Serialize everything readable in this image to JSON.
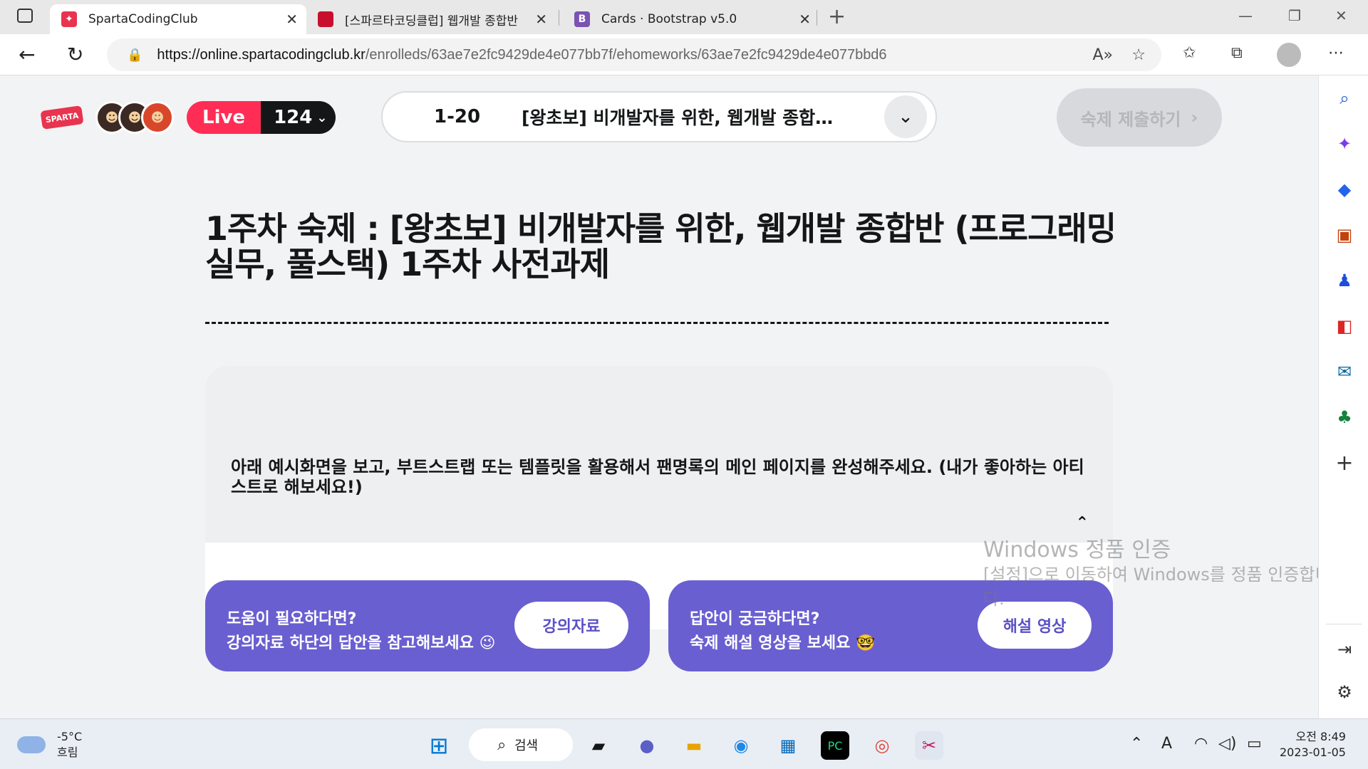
{
  "browser": {
    "tabs": [
      {
        "label": "SpartaCodingClub",
        "active": true,
        "favicon_color": "#e8344e"
      },
      {
        "label": "[스파르타코딩클럽] 웹개발 종합반",
        "active": false,
        "favicon_color": "#c8102e"
      },
      {
        "label": "Cards · Bootstrap v5.0",
        "active": false,
        "favicon_color": "#7952b3",
        "favicon_letter": "B"
      }
    ],
    "url_domain": "https://online.spartacodingclub.kr",
    "url_path": "/enrolleds/63ae7e2fc9429de4e077bb7f/ehomeworks/63ae7e2fc9429de4e077bbd6"
  },
  "header": {
    "logo_text": "SPARTA",
    "live_label": "Live",
    "live_count": "124",
    "selector_num": "1-20",
    "selector_title": "[왕초보] 비개발자를 위한, 웹개발 종합반 (…",
    "submit_label": "숙제 제출하기"
  },
  "homework": {
    "title": "1주차 숙제 : [왕초보] 비개발자를 위한, 웹개발 종합반 (프로그래밍 실무, 풀스택) 1주차 사전과제",
    "question": "아래 예시화면을 보고, 부트스트랩 또는 템플릿을 활용해서 팬명록의 메인 페이지를 완성해주세요. (내가 좋아하는 아티스트로 해보세요!)"
  },
  "cards": [
    {
      "line1": "도움이 필요하다면?",
      "line2": "강의자료 하단의 답안을 참고해보세요",
      "emoji": "😉",
      "button": "강의자료"
    },
    {
      "line1": "답안이 궁금하다면?",
      "line2": "숙제 해설 영상을 보세요",
      "emoji": "🤓",
      "button": "해설 영상"
    }
  ],
  "watermark": {
    "line1": "Windows 정품 인증",
    "line2": "[설정]으로 이동하여 Windows를 정품 인증합니",
    "line3": "다."
  },
  "taskbar": {
    "weather_temp": "-5°C",
    "weather_desc": "흐림",
    "search_label": "검색",
    "time": "오전 8:49",
    "date": "2023-01-05"
  },
  "colors": {
    "accent": "#6a5fd0",
    "live_red": "#ff2d55",
    "brand": "#e8344e"
  }
}
